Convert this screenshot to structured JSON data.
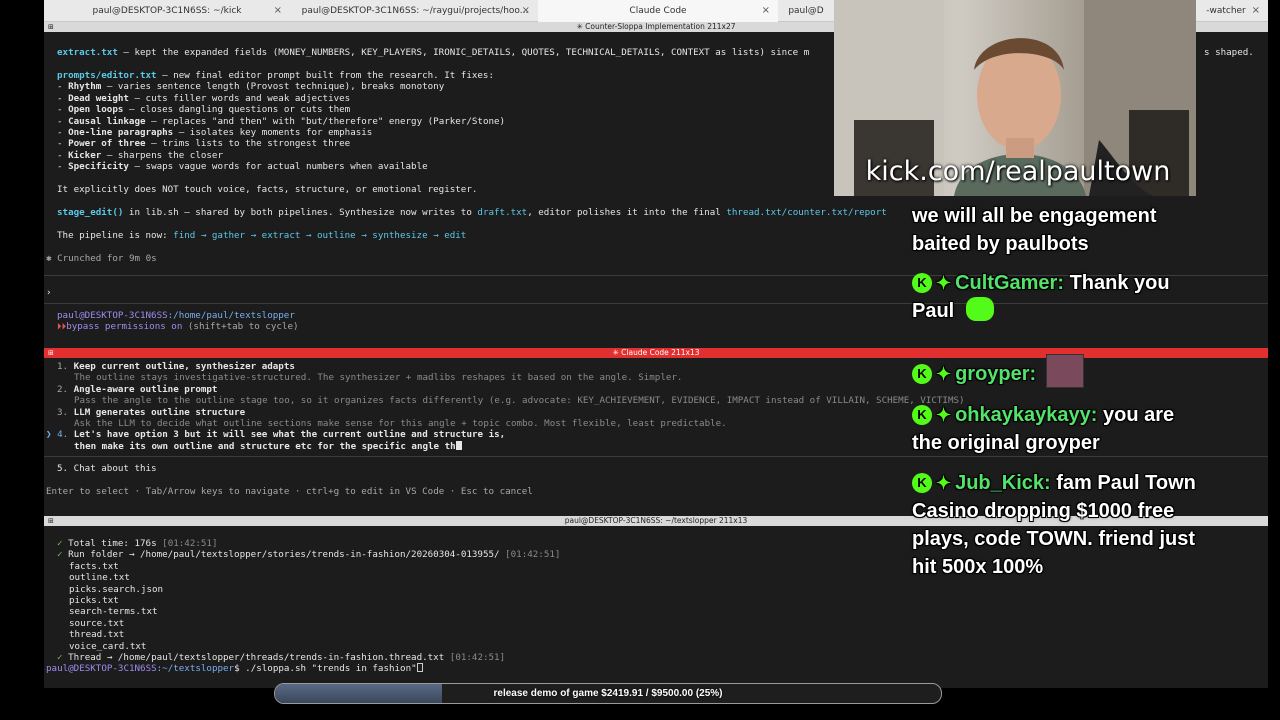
{
  "tabs": [
    {
      "label": "paul@DESKTOP-3C1N6SS: ~/kick",
      "active": false
    },
    {
      "label": "paul@DESKTOP-3C1N6SS: ~/raygui/projects/hoo...",
      "active": false
    },
    {
      "label": "Claude Code",
      "active": true
    },
    {
      "label": "paul@D",
      "active": false
    },
    {
      "label": "-watcher",
      "active": false
    }
  ],
  "pane1": {
    "title": "✳ Counter-Sloppa Implementation 211x27",
    "extract_file": "extract.txt",
    "extract_text": " — kept the expanded fields (MONEY_NUMBERS, KEY_PLAYERS, IRONIC_DETAILS, QUOTES, TECHNICAL_DETAILS, CONTEXT as lists) since m",
    "extract_tail": "s shaped.",
    "prompt_file": "prompts/editor.txt",
    "prompt_text": " — new final editor prompt built from the research. It fixes:",
    "fixes": [
      {
        "name": "Rhythm",
        "desc": " — varies sentence length (Provost technique), breaks monotony"
      },
      {
        "name": "Dead weight",
        "desc": " — cuts filler words and weak adjectives"
      },
      {
        "name": "Open loops",
        "desc": " — closes dangling questions or cuts them"
      },
      {
        "name": "Causal linkage",
        "desc": " — replaces \"and then\" with \"but/therefore\" energy (Parker/Stone)"
      },
      {
        "name": "One-line paragraphs",
        "desc": " — isolates key moments for emphasis"
      },
      {
        "name": "Power of three",
        "desc": " — trims lists to the strongest three"
      },
      {
        "name": "Kicker",
        "desc": " — sharpens the closer"
      },
      {
        "name": "Specificity",
        "desc": " — swaps vague words for actual numbers when available"
      }
    ],
    "not_touch": "It explicitly does NOT touch voice, facts, structure, or emotional register.",
    "stage_fn": "stage_edit()",
    "stage_a": " in lib.sh — shared by both pipelines. Synthesize now writes to ",
    "stage_draft": "draft.txt",
    "stage_b": ", editor polishes it into the final ",
    "stage_files": "thread.txt/counter.txt/report",
    "pipeline_label": "The pipeline is now: ",
    "pipeline_steps": "find → gather → extract → outline → synthesize → edit",
    "crunched": "✱ Crunched for 9m 0s",
    "prompt_char": "›",
    "shell_user": "paul@DESKTOP-3C1N6SS",
    "shell_path": ":/home/paul/textslopper",
    "bypass_icon": "⏵⏵",
    "bypass_text": "bypass permissions on",
    "bypass_hint": " (shift+tab to cycle)"
  },
  "pane2": {
    "title": "✳ Claude Code 211x13",
    "options": [
      {
        "num": "1.",
        "title": "Keep current outline, synthesizer adapts",
        "desc": "The outline stays investigative-structured. The synthesizer + madlibs reshapes it based on the angle. Simpler."
      },
      {
        "num": "2.",
        "title": "Angle-aware outline prompt",
        "desc": "Pass the angle to the outline stage too, so it organizes facts differently (e.g. advocate: KEY_ACHIEVEMENT, EVIDENCE, IMPACT instead of VILLAIN, SCHEME, VICTIMS)"
      },
      {
        "num": "3.",
        "title": "LLM generates outline structure",
        "desc": "Ask the LLM to decide what outline sections make sense for this angle + topic combo. Most flexible, least predictable."
      }
    ],
    "selected_marker": "❯",
    "option4_num": "4.",
    "option4_line1": "Let's have option 3 but it will see what the current outline and structure is,",
    "option4_line2": "then make its own outline and structure etc for the specific angle th",
    "option5": "5. Chat about this",
    "help": "Enter to select · Tab/Arrow keys to navigate · ctrl+g to edit in VS Code · Esc to cancel"
  },
  "pane3": {
    "title": "paul@DESKTOP-3C1N6SS: ~/textslopper 211x13",
    "check": "✓",
    "total_time": "Total time: 176s",
    "ts1": "[01:42:51]",
    "run_folder": "Run folder → /home/paul/textslopper/stories/trends-in-fashion/20260304-013955/",
    "ts2": "[01:42:51]",
    "files": [
      "facts.txt",
      "outline.txt",
      "picks.search.json",
      "picks.txt",
      "search-terms.txt",
      "source.txt",
      "thread.txt",
      "voice_card.txt"
    ],
    "thread_line": "Thread → /home/paul/textslopper/threads/trends-in-fashion.thread.txt",
    "ts3": "[01:42:51]",
    "prompt_user": "paul@DESKTOP-3C1N6SS",
    "prompt_path": ":~/textslopper",
    "prompt_cmd": "$ ./sloppa.sh \"trends in fashion\""
  },
  "stream": {
    "url": "kick.com/realpaultown",
    "chat": [
      {
        "user": "",
        "text": "we will all be engagement baited by paulbots"
      },
      {
        "user": "CultGamer:",
        "text": "Thank you Paul"
      },
      {
        "user": "groyper:",
        "text": ""
      },
      {
        "user": "ohkaykaykayy:",
        "text": "you are the original groyper"
      },
      {
        "user": "Jub_Kick:",
        "text": "fam Paul Town Casino dropping $1000 free plays, code TOWN. friend just hit 500x 100%"
      }
    ],
    "donation_text": "release demo of game $2419.91 / $9500.00 (25%)",
    "donation_progress": 0.25
  },
  "colors": {
    "kick_green": "#53fc18",
    "pane_active": "#e23030",
    "terminal_bg": "#1c1c1c"
  }
}
